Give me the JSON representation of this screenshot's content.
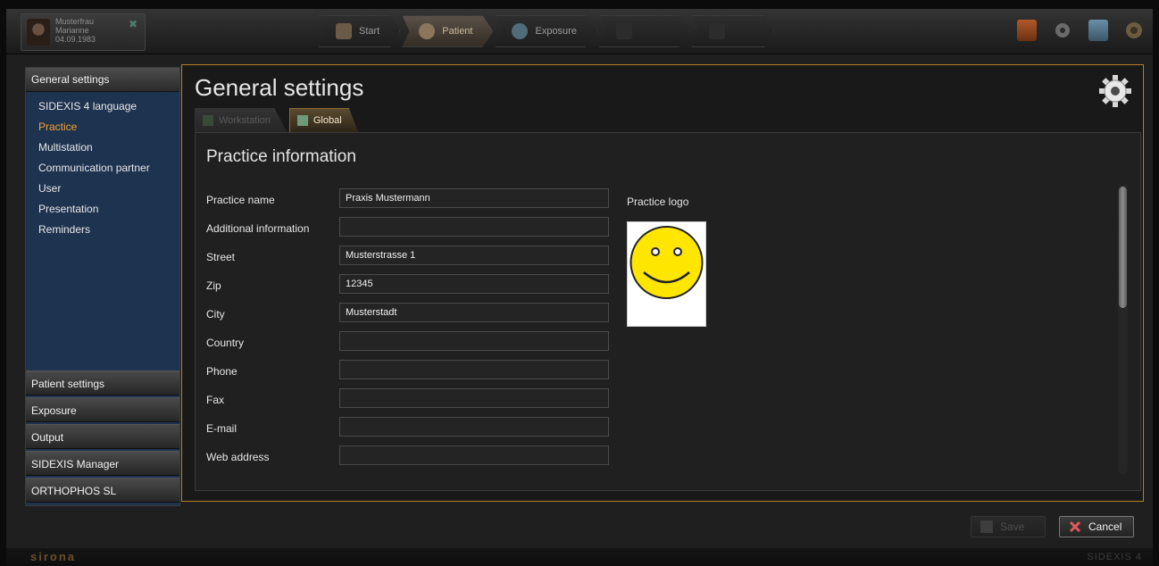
{
  "patient": {
    "last_name": "Musterfrau",
    "first_name": "Marianne",
    "birth_date": "04.09.1983"
  },
  "workflow": [
    {
      "label": "Start",
      "state": "normal"
    },
    {
      "label": "Patient",
      "state": "active"
    },
    {
      "label": "Exposure",
      "state": "normal"
    },
    {
      "label": "",
      "state": "dim"
    },
    {
      "label": "",
      "state": "dim"
    }
  ],
  "toolbar_icons": [
    "book-icon",
    "gear-icon",
    "monitor-icon",
    "power-icon"
  ],
  "nav": {
    "general_header": "General settings",
    "general_items": [
      {
        "label": "SIDEXIS 4 language",
        "active": false
      },
      {
        "label": "Practice",
        "active": true
      },
      {
        "label": "Multistation",
        "active": false
      },
      {
        "label": "Communication partner",
        "active": false
      },
      {
        "label": "User",
        "active": false
      },
      {
        "label": "Presentation",
        "active": false
      },
      {
        "label": "Reminders",
        "active": false
      }
    ],
    "sections": [
      "Patient settings",
      "Exposure",
      "Output",
      "SIDEXIS Manager",
      "ORTHOPHOS SL"
    ]
  },
  "main": {
    "title": "General settings",
    "tabs": [
      {
        "label": "Workstation",
        "active": false
      },
      {
        "label": "Global",
        "active": true
      }
    ],
    "section_title": "Practice information",
    "fields": [
      {
        "label": "Practice name",
        "value": "Praxis Mustermann"
      },
      {
        "label": "Additional information",
        "value": ""
      },
      {
        "label": "Street",
        "value": "Musterstrasse 1"
      },
      {
        "label": "Zip",
        "value": "12345"
      },
      {
        "label": "City",
        "value": "Musterstadt"
      },
      {
        "label": "Country",
        "value": ""
      },
      {
        "label": "Phone",
        "value": ""
      },
      {
        "label": "Fax",
        "value": ""
      },
      {
        "label": "E-mail",
        "value": ""
      },
      {
        "label": "Web address",
        "value": ""
      }
    ],
    "logo_label": "Practice logo"
  },
  "buttons": {
    "save": "Save",
    "cancel": "Cancel"
  },
  "footer": {
    "brand": "sirona",
    "product": "SIDEXIS 4"
  },
  "colors": {
    "accent": "#f0a22e",
    "panel_border": "#b38025",
    "nav_bg": "#1e3350"
  }
}
